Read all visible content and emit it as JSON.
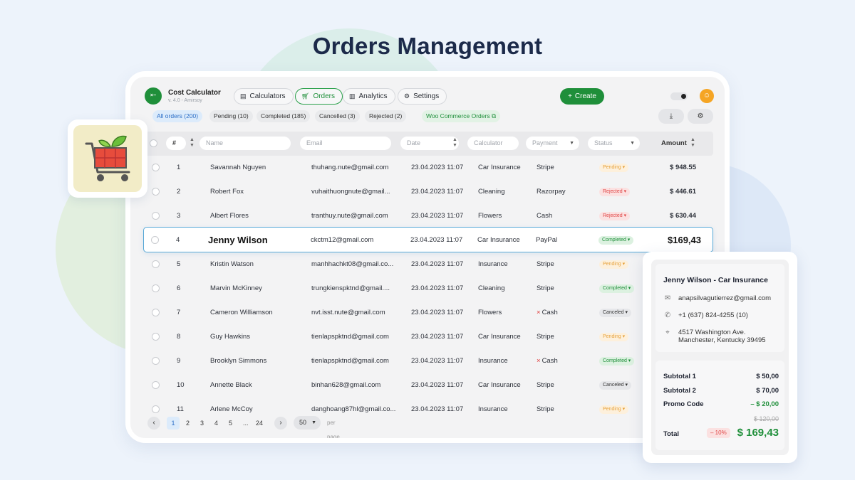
{
  "page_title": "Orders Management",
  "app": {
    "name": "Cost Calculator",
    "version": "v. 4.0 - Amirsoy"
  },
  "nav": [
    {
      "label": "Calculators",
      "icon": "calculator-icon"
    },
    {
      "label": "Orders",
      "icon": "cart-icon",
      "active": true
    },
    {
      "label": "Analytics",
      "icon": "chart-icon"
    },
    {
      "label": "Settings",
      "icon": "gear-icon"
    }
  ],
  "create_label": "Create",
  "filters": [
    {
      "label": "All orders (200)",
      "active": true
    },
    {
      "label": "Pending (10)"
    },
    {
      "label": "Completed (185)"
    },
    {
      "label": "Cancelled (3)"
    },
    {
      "label": "Rejected (2)"
    }
  ],
  "woo_label": "Woo Commerce Orders",
  "table": {
    "headers": {
      "num": "#",
      "name": "Name",
      "email": "Email",
      "date": "Date",
      "calculator": "Calculator",
      "payment": "Payment",
      "status": "Status",
      "amount": "Amount"
    },
    "rows": [
      {
        "num": "1",
        "name": "Savannah Nguyen",
        "email": "thuhang.nute@gmail.com",
        "date": "23.04.2023 11:07",
        "calculator": "Car Insurance",
        "payment": "Stripe",
        "status": "Pending",
        "amount": "$ 948.55"
      },
      {
        "num": "2",
        "name": "Robert Fox",
        "email": "vuhaithuongnute@gmail...",
        "date": "23.04.2023 11:07",
        "calculator": "Cleaning",
        "payment": "Razorpay",
        "status": "Rejected",
        "amount": "$ 446.61"
      },
      {
        "num": "3",
        "name": "Albert Flores",
        "email": "tranthuy.nute@gmail.com",
        "date": "23.04.2023 11:07",
        "calculator": "Flowers",
        "payment": "Cash",
        "status": "Rejected",
        "amount": "$ 630.44"
      },
      {
        "num": "4",
        "name": "Jenny Wilson",
        "email": "ckctm12@gmail.com",
        "date": "23.04.2023 11:07",
        "calculator": "Car Insurance",
        "payment": "PayPal",
        "status": "Completed",
        "amount": "$169,43"
      },
      {
        "num": "5",
        "name": "Kristin Watson",
        "email": "manhhachkt08@gmail.co...",
        "date": "23.04.2023 11:07",
        "calculator": "Insurance",
        "payment": "Stripe",
        "status": "Pending",
        "amount": ""
      },
      {
        "num": "6",
        "name": "Marvin McKinney",
        "email": "trungkienspktnd@gmail....",
        "date": "23.04.2023 11:07",
        "calculator": "Cleaning",
        "payment": "Stripe",
        "status": "Completed",
        "amount": ""
      },
      {
        "num": "7",
        "name": "Cameron Williamson",
        "email": "nvt.isst.nute@gmail.com",
        "date": "23.04.2023 11:07",
        "calculator": "Flowers",
        "payment": "Cash",
        "status": "Canceled",
        "amount": ""
      },
      {
        "num": "8",
        "name": "Guy Hawkins",
        "email": "tienlapspktnd@gmail.com",
        "date": "23.04.2023 11:07",
        "calculator": "Car Insurance",
        "payment": "Stripe",
        "status": "Pending",
        "amount": ""
      },
      {
        "num": "9",
        "name": "Brooklyn Simmons",
        "email": "tienlapspktnd@gmail.com",
        "date": "23.04.2023 11:07",
        "calculator": "Insurance",
        "payment": "Cash",
        "status": "Completed",
        "amount": ""
      },
      {
        "num": "10",
        "name": "Annette Black",
        "email": "binhan628@gmail.com",
        "date": "23.04.2023 11:07",
        "calculator": "Car Insurance",
        "payment": "Stripe",
        "status": "Canceled",
        "amount": ""
      },
      {
        "num": "11",
        "name": "Arlene McCoy",
        "email": "danghoang87hl@gmail.co...",
        "date": "23.04.2023 11:07",
        "calculator": "Insurance",
        "payment": "Stripe",
        "status": "Pending",
        "amount": ""
      }
    ]
  },
  "pagination": {
    "pages": [
      "1",
      "2",
      "3",
      "4",
      "5",
      "...",
      "24"
    ],
    "current": "1",
    "page_size": "50",
    "per_page_label": "per page"
  },
  "detail": {
    "title": "Jenny Wilson - Car Insurance",
    "email": "anapsilvagutierrez@gmail.com",
    "phone": "+1 (637) 824-4255 (10)",
    "address_line1": "4517 Washington Ave.",
    "address_line2": "Manchester, Kentucky 39495",
    "subtotal1_label": "Subtotal 1",
    "subtotal1": "$ 50,00",
    "subtotal2_label": "Subtotal 2",
    "subtotal2": "$ 70,00",
    "promo_label": "Promo Code",
    "promo": "– $ 20,00",
    "old_total": "$ 120,00",
    "total_label": "Total",
    "discount": "– 10%",
    "total": "$ 169,43"
  },
  "colors": {
    "primary_green": "#1f8f3a",
    "accent_blue": "#2d6fc7",
    "pending": "#e6a23c",
    "rejected": "#e04545"
  }
}
